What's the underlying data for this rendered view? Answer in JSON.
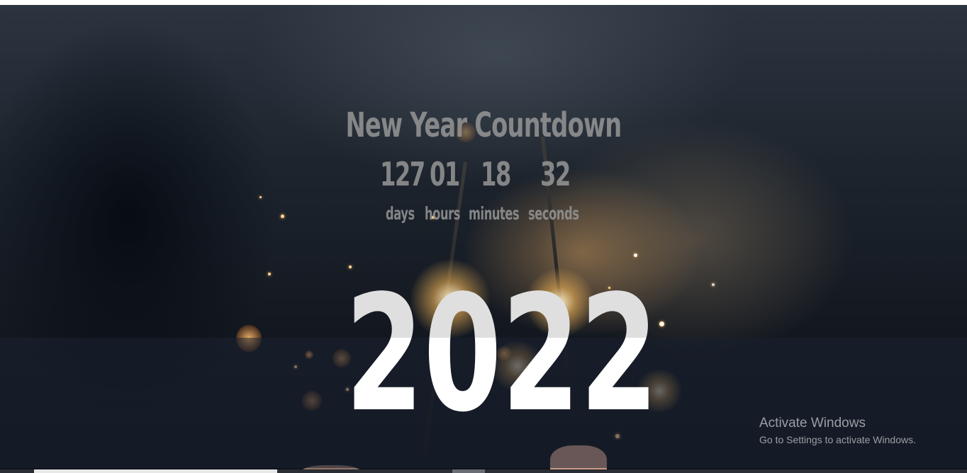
{
  "countdown": {
    "title": "New Year Countdown",
    "days_value": "127",
    "hours_value": "01",
    "minutes_value": "18",
    "seconds_value": "32",
    "days_label": "days",
    "hours_label": "hours",
    "minutes_label": "minutes",
    "seconds_label": "seconds"
  },
  "year_banner": {
    "year": "2022"
  },
  "watermark": {
    "title": "Activate Windows",
    "subtitle": "Go to Settings to activate Windows."
  },
  "colors": {
    "background": "#131820",
    "text_muted": "#969696",
    "year_text": "#ffffff",
    "band_overlay": "#192130"
  },
  "scroll": {
    "horizontal_scroll_fraction": 0.03
  }
}
